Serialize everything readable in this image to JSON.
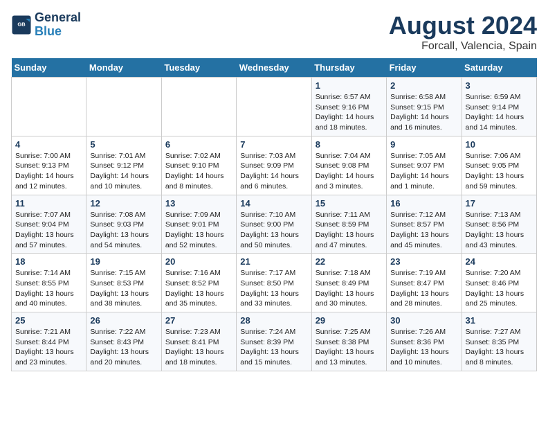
{
  "header": {
    "logo_line1": "General",
    "logo_line2": "Blue",
    "title": "August 2024",
    "subtitle": "Forcall, Valencia, Spain"
  },
  "days_of_week": [
    "Sunday",
    "Monday",
    "Tuesday",
    "Wednesday",
    "Thursday",
    "Friday",
    "Saturday"
  ],
  "weeks": [
    [
      {
        "day": "",
        "info": ""
      },
      {
        "day": "",
        "info": ""
      },
      {
        "day": "",
        "info": ""
      },
      {
        "day": "",
        "info": ""
      },
      {
        "day": "1",
        "info": "Sunrise: 6:57 AM\nSunset: 9:16 PM\nDaylight: 14 hours\nand 18 minutes."
      },
      {
        "day": "2",
        "info": "Sunrise: 6:58 AM\nSunset: 9:15 PM\nDaylight: 14 hours\nand 16 minutes."
      },
      {
        "day": "3",
        "info": "Sunrise: 6:59 AM\nSunset: 9:14 PM\nDaylight: 14 hours\nand 14 minutes."
      }
    ],
    [
      {
        "day": "4",
        "info": "Sunrise: 7:00 AM\nSunset: 9:13 PM\nDaylight: 14 hours\nand 12 minutes."
      },
      {
        "day": "5",
        "info": "Sunrise: 7:01 AM\nSunset: 9:12 PM\nDaylight: 14 hours\nand 10 minutes."
      },
      {
        "day": "6",
        "info": "Sunrise: 7:02 AM\nSunset: 9:10 PM\nDaylight: 14 hours\nand 8 minutes."
      },
      {
        "day": "7",
        "info": "Sunrise: 7:03 AM\nSunset: 9:09 PM\nDaylight: 14 hours\nand 6 minutes."
      },
      {
        "day": "8",
        "info": "Sunrise: 7:04 AM\nSunset: 9:08 PM\nDaylight: 14 hours\nand 3 minutes."
      },
      {
        "day": "9",
        "info": "Sunrise: 7:05 AM\nSunset: 9:07 PM\nDaylight: 14 hours\nand 1 minute."
      },
      {
        "day": "10",
        "info": "Sunrise: 7:06 AM\nSunset: 9:05 PM\nDaylight: 13 hours\nand 59 minutes."
      }
    ],
    [
      {
        "day": "11",
        "info": "Sunrise: 7:07 AM\nSunset: 9:04 PM\nDaylight: 13 hours\nand 57 minutes."
      },
      {
        "day": "12",
        "info": "Sunrise: 7:08 AM\nSunset: 9:03 PM\nDaylight: 13 hours\nand 54 minutes."
      },
      {
        "day": "13",
        "info": "Sunrise: 7:09 AM\nSunset: 9:01 PM\nDaylight: 13 hours\nand 52 minutes."
      },
      {
        "day": "14",
        "info": "Sunrise: 7:10 AM\nSunset: 9:00 PM\nDaylight: 13 hours\nand 50 minutes."
      },
      {
        "day": "15",
        "info": "Sunrise: 7:11 AM\nSunset: 8:59 PM\nDaylight: 13 hours\nand 47 minutes."
      },
      {
        "day": "16",
        "info": "Sunrise: 7:12 AM\nSunset: 8:57 PM\nDaylight: 13 hours\nand 45 minutes."
      },
      {
        "day": "17",
        "info": "Sunrise: 7:13 AM\nSunset: 8:56 PM\nDaylight: 13 hours\nand 43 minutes."
      }
    ],
    [
      {
        "day": "18",
        "info": "Sunrise: 7:14 AM\nSunset: 8:55 PM\nDaylight: 13 hours\nand 40 minutes."
      },
      {
        "day": "19",
        "info": "Sunrise: 7:15 AM\nSunset: 8:53 PM\nDaylight: 13 hours\nand 38 minutes."
      },
      {
        "day": "20",
        "info": "Sunrise: 7:16 AM\nSunset: 8:52 PM\nDaylight: 13 hours\nand 35 minutes."
      },
      {
        "day": "21",
        "info": "Sunrise: 7:17 AM\nSunset: 8:50 PM\nDaylight: 13 hours\nand 33 minutes."
      },
      {
        "day": "22",
        "info": "Sunrise: 7:18 AM\nSunset: 8:49 PM\nDaylight: 13 hours\nand 30 minutes."
      },
      {
        "day": "23",
        "info": "Sunrise: 7:19 AM\nSunset: 8:47 PM\nDaylight: 13 hours\nand 28 minutes."
      },
      {
        "day": "24",
        "info": "Sunrise: 7:20 AM\nSunset: 8:46 PM\nDaylight: 13 hours\nand 25 minutes."
      }
    ],
    [
      {
        "day": "25",
        "info": "Sunrise: 7:21 AM\nSunset: 8:44 PM\nDaylight: 13 hours\nand 23 minutes."
      },
      {
        "day": "26",
        "info": "Sunrise: 7:22 AM\nSunset: 8:43 PM\nDaylight: 13 hours\nand 20 minutes."
      },
      {
        "day": "27",
        "info": "Sunrise: 7:23 AM\nSunset: 8:41 PM\nDaylight: 13 hours\nand 18 minutes."
      },
      {
        "day": "28",
        "info": "Sunrise: 7:24 AM\nSunset: 8:39 PM\nDaylight: 13 hours\nand 15 minutes."
      },
      {
        "day": "29",
        "info": "Sunrise: 7:25 AM\nSunset: 8:38 PM\nDaylight: 13 hours\nand 13 minutes."
      },
      {
        "day": "30",
        "info": "Sunrise: 7:26 AM\nSunset: 8:36 PM\nDaylight: 13 hours\nand 10 minutes."
      },
      {
        "day": "31",
        "info": "Sunrise: 7:27 AM\nSunset: 8:35 PM\nDaylight: 13 hours\nand 8 minutes."
      }
    ]
  ]
}
